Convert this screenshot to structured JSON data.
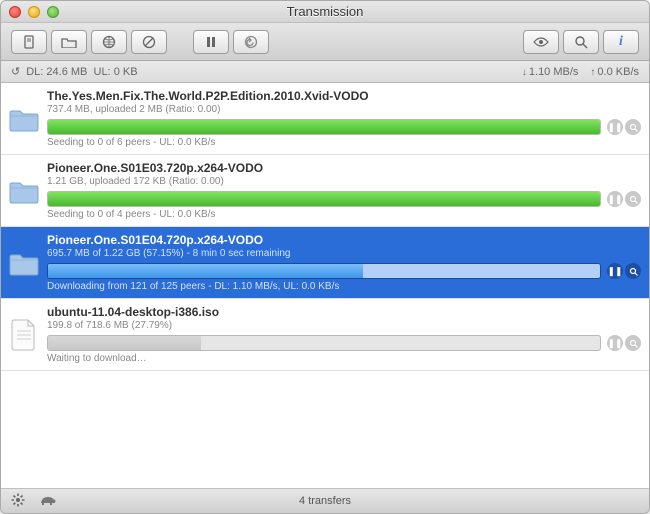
{
  "window": {
    "title": "Transmission"
  },
  "stats": {
    "dl_label": "DL:",
    "dl_value": "24.6 MB",
    "ul_label": "UL:",
    "ul_value": "0 KB",
    "down_rate": "1.10 MB/s",
    "up_rate": "0.0 KB/s"
  },
  "rows": [
    {
      "title": "The.Yes.Men.Fix.The.World.P2P.Edition.2010.Xvid-VODO",
      "meta": "737.4 MB, uploaded 2 MB (Ratio: 0.00)",
      "status": "Seeding to 0 of 6 peers - UL: 0.0 KB/s",
      "progress": 100,
      "mode": "seed",
      "icon": "folder",
      "selected": false
    },
    {
      "title": "Pioneer.One.S01E03.720p.x264-VODO",
      "meta": "1.21 GB, uploaded 172 KB (Ratio: 0.00)",
      "status": "Seeding to 0 of 4 peers - UL: 0.0 KB/s",
      "progress": 100,
      "mode": "seed",
      "icon": "folder",
      "selected": false
    },
    {
      "title": "Pioneer.One.S01E04.720p.x264-VODO",
      "meta": "695.7 MB of 1.22 GB (57.15%) - 8 min 0 sec remaining",
      "status": "Downloading from 121 of 125 peers - DL: 1.10 MB/s, UL: 0.0 KB/s",
      "progress": 57.15,
      "mode": "dl",
      "icon": "folder",
      "selected": true
    },
    {
      "title": "ubuntu-11.04-desktop-i386.iso",
      "meta": "199.8 of 718.6 MB (27.79%)",
      "status": "Waiting to download…",
      "progress": 27.79,
      "mode": "paused",
      "icon": "file",
      "selected": false
    }
  ],
  "footer": {
    "count": "4 transfers"
  }
}
